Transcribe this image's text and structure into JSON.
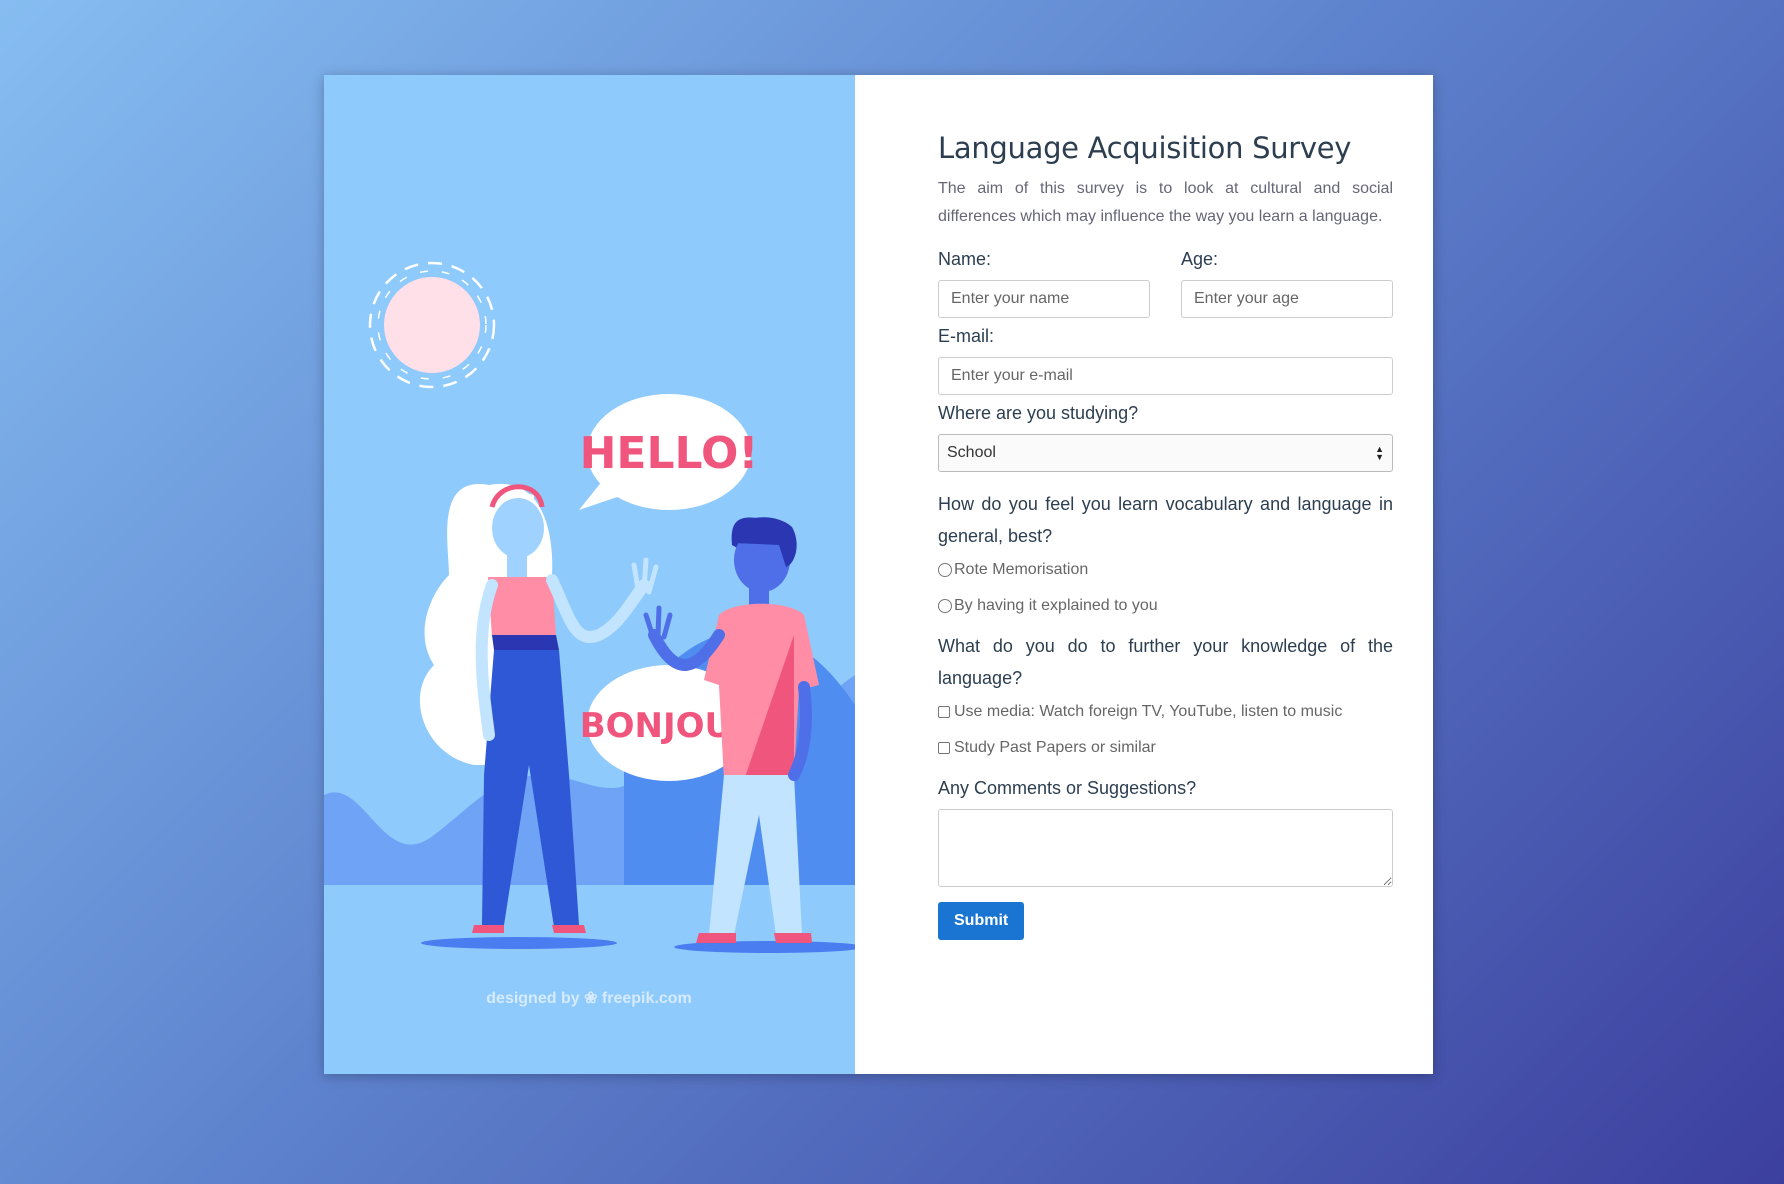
{
  "illustration": {
    "bubble_hello": "HELLO!",
    "bubble_bonjour": "BONJOUR",
    "credit_prefix": "designed by",
    "credit_brand": "freepik.com"
  },
  "form": {
    "title": "Language Acquisition Survey",
    "description": "The aim of this survey is to look at cultural and social differences which may influence the way you learn a language.",
    "name_label": "Name:",
    "name_placeholder": "Enter your name",
    "age_label": "Age:",
    "age_placeholder": "Enter your age",
    "email_label": "E-mail:",
    "email_placeholder": "Enter your e-mail",
    "study_label": "Where are you studying?",
    "study_selected": "School",
    "q1": "How do you feel you learn vocabulary and language in general, best?",
    "q1_options": [
      "Rote Memorisation",
      "By having it explained to you"
    ],
    "q2": "What do you do to further your knowledge of the language?",
    "q2_options": [
      "Use media: Watch foreign TV, YouTube, listen to music",
      "Study Past Papers or similar"
    ],
    "comments_label": "Any Comments or Suggestions?",
    "submit_label": "Submit"
  },
  "colors": {
    "page_gradient_start": "#86bdf1",
    "page_gradient_end": "#3c3f9e",
    "illustration_bg": "#8ecafb",
    "accent_pink": "#f0567d",
    "submit_blue": "#1a74d2"
  }
}
